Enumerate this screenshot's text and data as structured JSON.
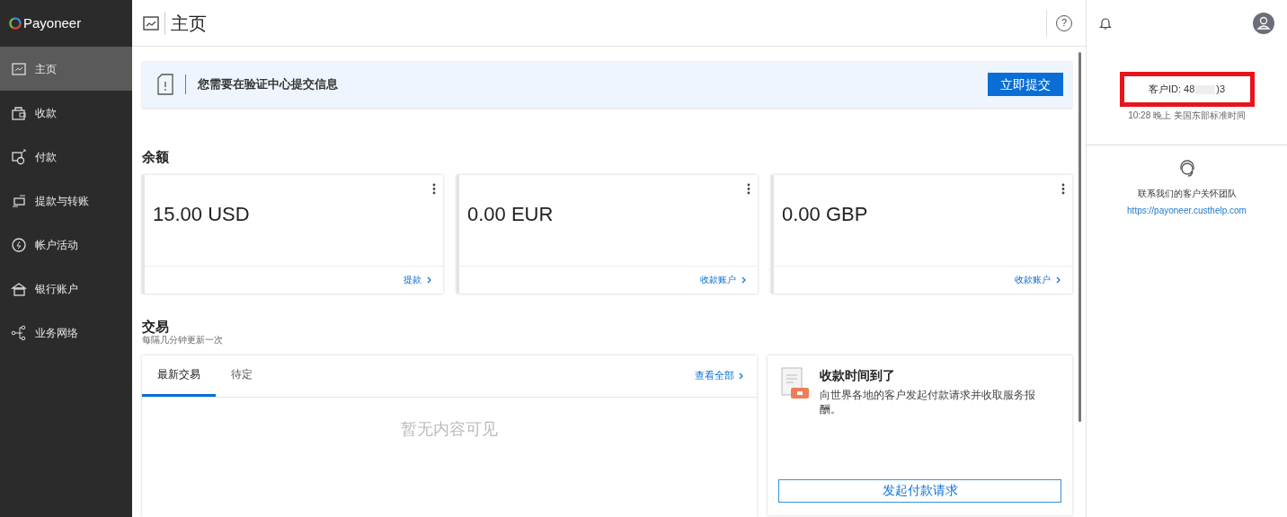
{
  "brand": "Payoneer",
  "sidebar": {
    "items": [
      {
        "label": "主页",
        "kind": "chart",
        "selected": true
      },
      {
        "label": "收款",
        "kind": "bag",
        "selected": false
      },
      {
        "label": "付款",
        "kind": "send",
        "selected": false
      },
      {
        "label": "提款与转账",
        "kind": "transfer",
        "selected": false
      },
      {
        "label": "帐户活动",
        "kind": "activity",
        "selected": false
      },
      {
        "label": "银行账户",
        "kind": "bank",
        "selected": false
      },
      {
        "label": "业务网络",
        "kind": "network",
        "selected": false
      }
    ]
  },
  "header": {
    "title": "主页",
    "help": "?"
  },
  "alert": {
    "message": "您需要在验证中心提交信息",
    "button": "立即提交"
  },
  "balances": {
    "title": "余额",
    "cards": [
      {
        "amount": "15.00 USD",
        "link": "提款"
      },
      {
        "amount": "0.00 EUR",
        "link": "收款账户"
      },
      {
        "amount": "0.00 GBP",
        "link": "收款账户"
      }
    ]
  },
  "transactions": {
    "title": "交易",
    "subtitle": "每隔几分钟更新一次",
    "tabs": [
      {
        "label": "最新交易",
        "selected": true
      },
      {
        "label": "待定",
        "selected": false
      }
    ],
    "view_all": "查看全部",
    "empty": "暂无内容可见"
  },
  "promo": {
    "title": "收款时间到了",
    "text": "向世界各地的客户发起付款请求并收取服务报酬。",
    "button": "发起付款请求"
  },
  "right_panel": {
    "customer_id_prefix": "客户ID: 48",
    "customer_id_suffix": ")3",
    "highlighted": true,
    "last_login": "10:28 晚上 美国东部标准时间",
    "support_title": "联系我们的客户关怀团队",
    "support_link": "https://payoneer.custhelp.com"
  }
}
